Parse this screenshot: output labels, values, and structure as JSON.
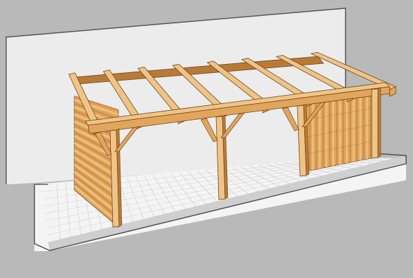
{
  "scene": {
    "subject": "timber-lean-to-carport-render",
    "colors": {
      "background": "#b9b9b9",
      "wall": "#ececec",
      "wall_edge": "#555555",
      "deck": "#f4f4f4",
      "deck_line": "#cfcfcf",
      "deck_edge": "#4a4a4a",
      "wood_light": "#f0c487",
      "wood_mid": "#e2a55c",
      "wood_dark": "#b97a36",
      "wood_outline": "#6a4418",
      "cladding_shadow": "#c98f4b"
    },
    "rafter_count": 8,
    "post_count": 4,
    "clad_bays": [
      "left-end",
      "right-end"
    ]
  }
}
